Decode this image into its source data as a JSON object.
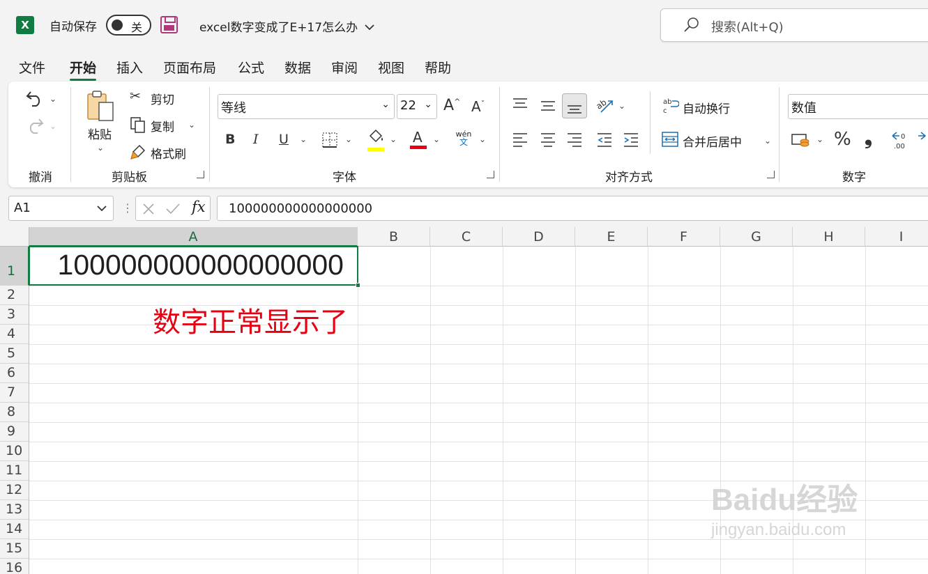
{
  "titlebar": {
    "app_icon_letter": "X",
    "autosave_label": "自动保存",
    "autosave_state": "关",
    "doc_title": "excel数字变成了E+17怎么办",
    "search_placeholder": "搜索(Alt+Q)"
  },
  "menu_tabs": [
    {
      "label": "文件"
    },
    {
      "label": "开始",
      "active": true
    },
    {
      "label": "插入"
    },
    {
      "label": "页面布局"
    },
    {
      "label": "公式"
    },
    {
      "label": "数据"
    },
    {
      "label": "审阅"
    },
    {
      "label": "视图"
    },
    {
      "label": "帮助"
    }
  ],
  "ribbon": {
    "undo_group": "撤消",
    "clipboard": {
      "paste": "粘贴",
      "cut": "剪切",
      "copy": "复制",
      "format_painter": "格式刷",
      "group": "剪贴板"
    },
    "font": {
      "font_name": "等线",
      "font_size": "22",
      "bold": "B",
      "italic": "I",
      "underline": "U",
      "phonetic_top": "wén",
      "phonetic_bottom": "文",
      "group": "字体",
      "highlight_color": "#ffff00",
      "font_color": "#e60012"
    },
    "alignment": {
      "wrap_text": "自动换行",
      "merge_center": "合并后居中",
      "group": "对齐方式"
    },
    "number": {
      "format": "数值",
      "percent": "%",
      "comma": "❟",
      "group": "数字"
    }
  },
  "formula_bar": {
    "name_box": "A1",
    "fx": "fx",
    "content": "100000000000000000"
  },
  "grid": {
    "columns": [
      "A",
      "B",
      "C",
      "D",
      "E",
      "F",
      "G",
      "H",
      "I"
    ],
    "rows": [
      "1",
      "2",
      "3",
      "4",
      "5",
      "6",
      "7",
      "8",
      "9",
      "10",
      "11",
      "12",
      "13",
      "14",
      "15",
      "16"
    ],
    "a1_value": "100000000000000000",
    "annotation": "数字正常显示了",
    "annotation_color": "#e60012"
  },
  "watermark": {
    "brand": "Baidu经验",
    "url": "jingyan.baidu.com"
  }
}
